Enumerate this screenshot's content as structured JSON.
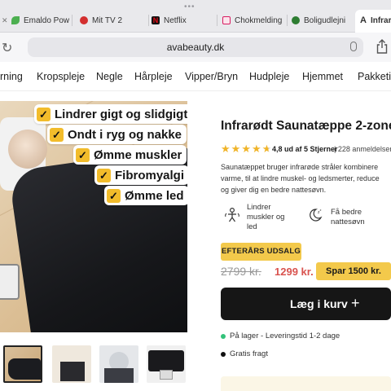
{
  "browser": {
    "tabs": [
      {
        "label": "Emaldo Pow",
        "color": "#4caf50"
      },
      {
        "label": "Mit TV 2",
        "color": "#d32f2f"
      },
      {
        "label": "Netflix",
        "color": "#e50914"
      },
      {
        "label": "Chokmelding",
        "color": "#d81b60"
      },
      {
        "label": "Boligudlejni",
        "color": "#2e7d32"
      },
      {
        "label": "Infrar",
        "color": "#111111"
      }
    ],
    "active_tab_initial": "A",
    "url": "avabeauty.dk"
  },
  "nav": {
    "items": [
      "rning",
      "Kropspleje",
      "Negle",
      "Hårpleje",
      "Vipper/Bryn",
      "Hudpleje",
      "Hjemmet",
      "Pakketi"
    ]
  },
  "hero": {
    "badges": [
      "Lindrer gigt og slidgigt",
      "Ondt i ryg og nakke",
      "Ømme muskler",
      "Fibromyalgi",
      "Ømme led"
    ],
    "check_glyph": "✓"
  },
  "thumbs": [
    {
      "caption": ""
    },
    {
      "caption": ""
    },
    {
      "caption": ""
    },
    {
      "caption": ""
    }
  ],
  "product": {
    "title": "Infrarødt Saunatæppe 2-zone",
    "rating_value": 4.8,
    "rating_text": "4,8 ud af 5 Stjerner",
    "reviews": "| 228 anmeldelser",
    "description_lines": [
      "Saunatæppet bruger infrarøde stråler kombinere",
      "varme, til at lindre muskel- og ledsmerter, reduce",
      "og giver dig en bedre nattesøvn."
    ],
    "features": [
      {
        "icon": "body-icon",
        "lines": [
          "Lindrer",
          "muskler og",
          "led"
        ]
      },
      {
        "icon": "sleep-icon",
        "lines": [
          "Få bedre",
          "nattesøvn"
        ]
      }
    ],
    "sale_badge": "EFTERÅRS UDSALG",
    "old_price": "2799 kr.",
    "new_price": "1299 kr.",
    "savings": "Spar 1500 kr.",
    "cart_button": "Læg i kurv",
    "cart_plus": "+",
    "stock": "På lager - Leveringstid 1-2 dage",
    "shipping": "Gratis fragt"
  },
  "colors": {
    "accent_yellow": "#f3c94b",
    "price_red": "#d9534f",
    "in_stock_green": "#33c27a",
    "button_black": "#161616"
  }
}
